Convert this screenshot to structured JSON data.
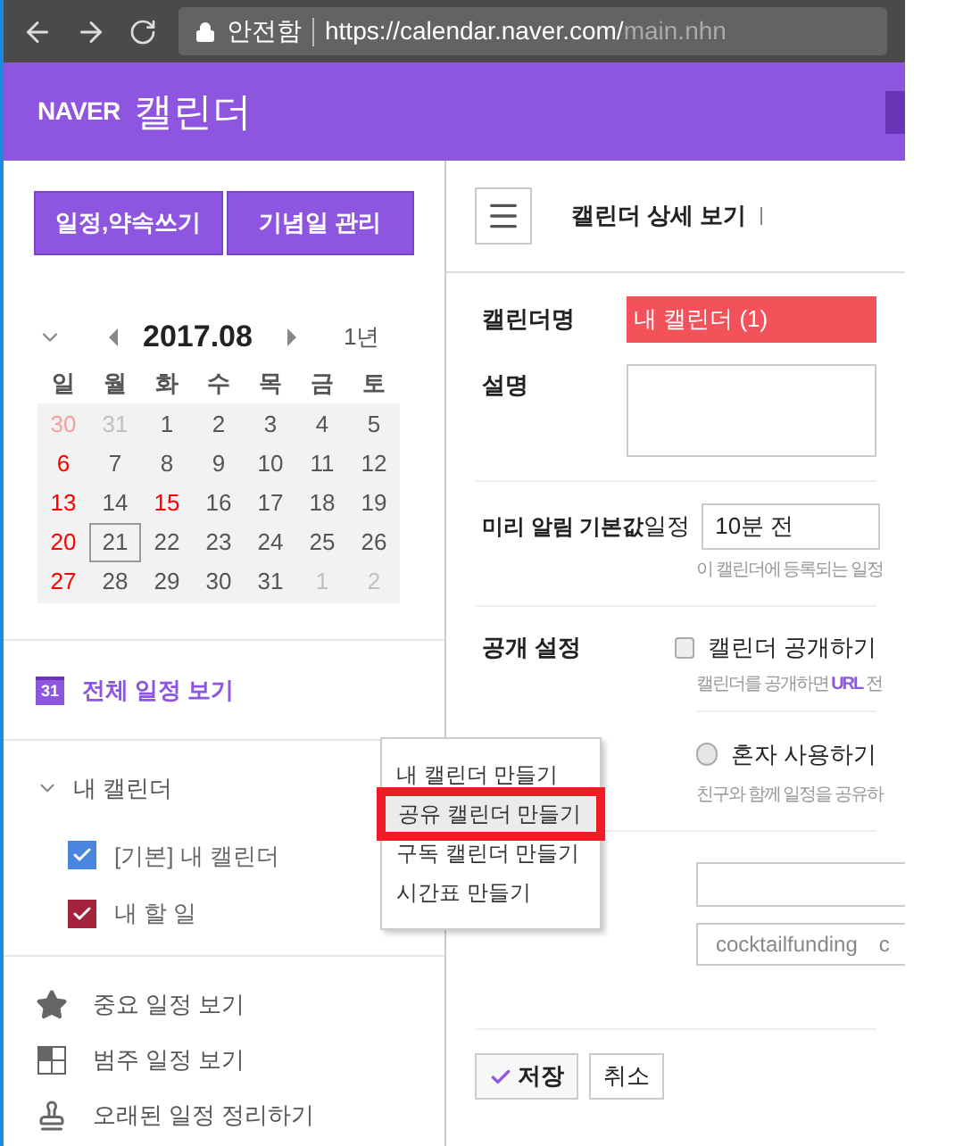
{
  "browser": {
    "security": "안전함",
    "url_host": "https://calendar.naver.com/",
    "url_path": "main.nhn"
  },
  "header": {
    "brand": "NAVER",
    "title": "캘린더"
  },
  "sidebar": {
    "buttons": [
      "일정,약속쓰기",
      "기념일 관리"
    ],
    "mini_calendar": {
      "month": "2017.08",
      "year_view": "1년",
      "weekdays": [
        "일",
        "월",
        "화",
        "수",
        "목",
        "금",
        "토"
      ],
      "days": [
        {
          "label": "30",
          "other_month": true,
          "red": true,
          "selected": false
        },
        {
          "label": "31",
          "other_month": true,
          "red": false,
          "selected": false
        },
        {
          "label": "1",
          "other_month": false,
          "red": false,
          "selected": false
        },
        {
          "label": "2",
          "other_month": false,
          "red": false,
          "selected": false
        },
        {
          "label": "3",
          "other_month": false,
          "red": false,
          "selected": false
        },
        {
          "label": "4",
          "other_month": false,
          "red": false,
          "selected": false
        },
        {
          "label": "5",
          "other_month": false,
          "red": false,
          "selected": false
        },
        {
          "label": "6",
          "other_month": false,
          "red": true,
          "selected": false
        },
        {
          "label": "7",
          "other_month": false,
          "red": false,
          "selected": false
        },
        {
          "label": "8",
          "other_month": false,
          "red": false,
          "selected": false
        },
        {
          "label": "9",
          "other_month": false,
          "red": false,
          "selected": false
        },
        {
          "label": "10",
          "other_month": false,
          "red": false,
          "selected": false
        },
        {
          "label": "11",
          "other_month": false,
          "red": false,
          "selected": false
        },
        {
          "label": "12",
          "other_month": false,
          "red": false,
          "selected": false
        },
        {
          "label": "13",
          "other_month": false,
          "red": true,
          "selected": false
        },
        {
          "label": "14",
          "other_month": false,
          "red": false,
          "selected": false
        },
        {
          "label": "15",
          "other_month": false,
          "red": true,
          "selected": false
        },
        {
          "label": "16",
          "other_month": false,
          "red": false,
          "selected": false
        },
        {
          "label": "17",
          "other_month": false,
          "red": false,
          "selected": false
        },
        {
          "label": "18",
          "other_month": false,
          "red": false,
          "selected": false
        },
        {
          "label": "19",
          "other_month": false,
          "red": false,
          "selected": false
        },
        {
          "label": "20",
          "other_month": false,
          "red": true,
          "selected": false
        },
        {
          "label": "21",
          "other_month": false,
          "red": false,
          "selected": true
        },
        {
          "label": "22",
          "other_month": false,
          "red": false,
          "selected": false
        },
        {
          "label": "23",
          "other_month": false,
          "red": false,
          "selected": false
        },
        {
          "label": "24",
          "other_month": false,
          "red": false,
          "selected": false
        },
        {
          "label": "25",
          "other_month": false,
          "red": false,
          "selected": false
        },
        {
          "label": "26",
          "other_month": false,
          "red": false,
          "selected": false
        },
        {
          "label": "27",
          "other_month": false,
          "red": true,
          "selected": false
        },
        {
          "label": "28",
          "other_month": false,
          "red": false,
          "selected": false
        },
        {
          "label": "29",
          "other_month": false,
          "red": false,
          "selected": false
        },
        {
          "label": "30",
          "other_month": false,
          "red": false,
          "selected": false
        },
        {
          "label": "31",
          "other_month": false,
          "red": false,
          "selected": false
        },
        {
          "label": "1",
          "other_month": true,
          "red": false,
          "selected": false
        },
        {
          "label": "2",
          "other_month": true,
          "red": false,
          "selected": false
        }
      ]
    },
    "all_schedule": {
      "icon_label": "31",
      "label": "전체 일정 보기"
    },
    "my_calendars": {
      "title": "내 캘린더",
      "expanded": true,
      "items": [
        {
          "label": "[기본] 내 캘린더",
          "color": "#4a86e0",
          "checked": true
        },
        {
          "label": "내 할 일",
          "color": "#a3213a",
          "checked": true
        }
      ]
    },
    "links": [
      {
        "kind": "star",
        "label": "중요 일정 보기"
      },
      {
        "kind": "legend",
        "label": "범주 일정 보기"
      },
      {
        "kind": "stamp",
        "label": "오래된 일정 정리하기"
      }
    ]
  },
  "context_menu": {
    "items": [
      {
        "label": "내 캘린더 만들기",
        "selected": false
      },
      {
        "label": "공유 캘린더 만들기",
        "selected": true
      },
      {
        "label": "구독 캘린더 만들기",
        "selected": false
      },
      {
        "label": "시간표 만들기",
        "selected": false
      }
    ]
  },
  "main": {
    "title": "캘린더 상세 보기",
    "name": {
      "label": "캘린더명",
      "value": "내 캘린더 (1)",
      "color": "#f4525a"
    },
    "description": {
      "label": "설명"
    },
    "reminder": {
      "label": "미리 알림 기본값",
      "prefix": "일정",
      "value": "10분 전",
      "hint": "이 캘린더에 등록되는 일정"
    },
    "public": {
      "label": "공개 설정",
      "option": "캘린더 공개하기",
      "checked": false,
      "hint_before": "캘린더를 공개하면 ",
      "hint_link": "URL",
      "hint_after": " 전"
    },
    "sharing": {
      "option": "혼자 사용하기",
      "selected": false,
      "hint": "친구와 함께 일정을 공유하"
    },
    "account": {
      "value": "cocktailfunding",
      "cut": "c"
    },
    "buttons": {
      "save": "저장",
      "cancel": "취소"
    }
  }
}
